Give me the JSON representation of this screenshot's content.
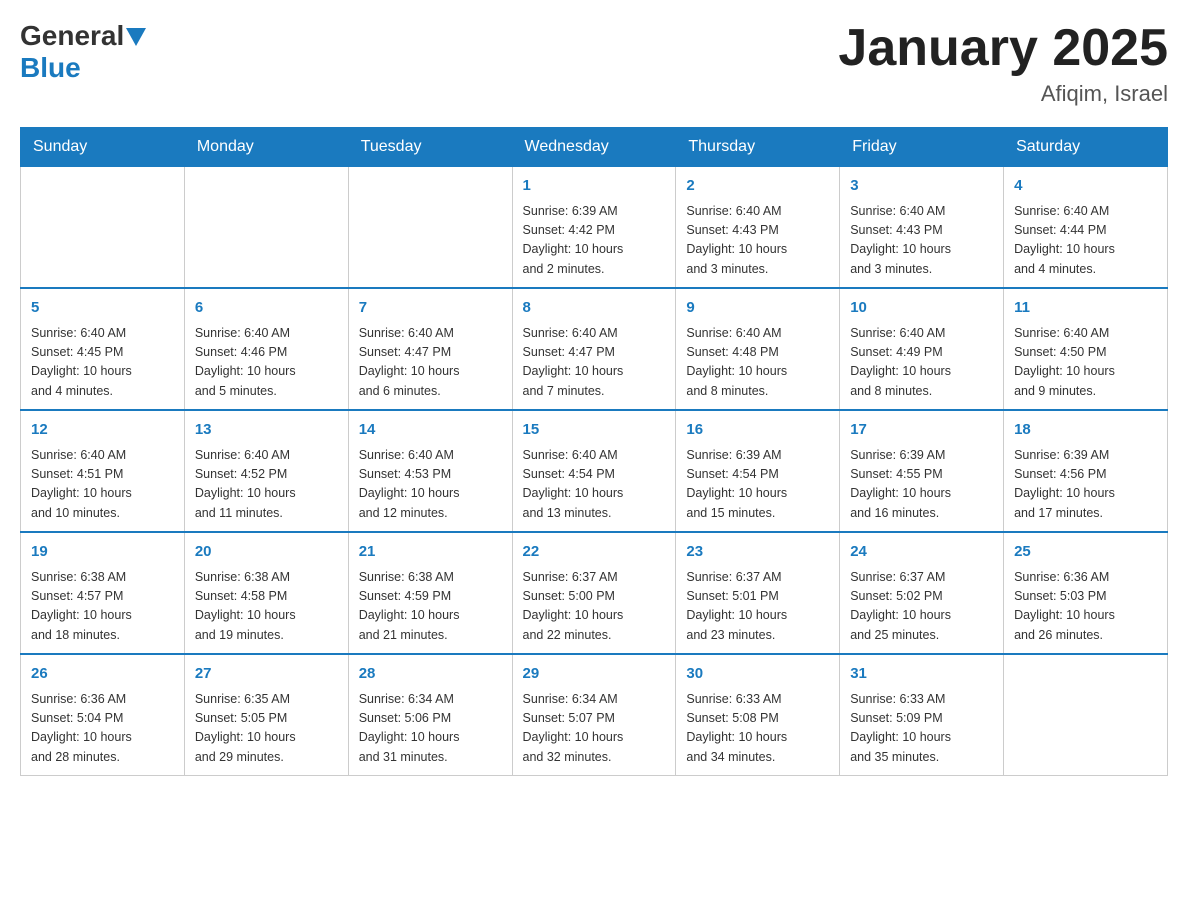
{
  "header": {
    "logo_general": "General",
    "logo_blue": "Blue",
    "month_title": "January 2025",
    "location": "Afiqim, Israel"
  },
  "days_of_week": [
    "Sunday",
    "Monday",
    "Tuesday",
    "Wednesday",
    "Thursday",
    "Friday",
    "Saturday"
  ],
  "weeks": [
    [
      {
        "day": "",
        "info": ""
      },
      {
        "day": "",
        "info": ""
      },
      {
        "day": "",
        "info": ""
      },
      {
        "day": "1",
        "info": "Sunrise: 6:39 AM\nSunset: 4:42 PM\nDaylight: 10 hours\nand 2 minutes."
      },
      {
        "day": "2",
        "info": "Sunrise: 6:40 AM\nSunset: 4:43 PM\nDaylight: 10 hours\nand 3 minutes."
      },
      {
        "day": "3",
        "info": "Sunrise: 6:40 AM\nSunset: 4:43 PM\nDaylight: 10 hours\nand 3 minutes."
      },
      {
        "day": "4",
        "info": "Sunrise: 6:40 AM\nSunset: 4:44 PM\nDaylight: 10 hours\nand 4 minutes."
      }
    ],
    [
      {
        "day": "5",
        "info": "Sunrise: 6:40 AM\nSunset: 4:45 PM\nDaylight: 10 hours\nand 4 minutes."
      },
      {
        "day": "6",
        "info": "Sunrise: 6:40 AM\nSunset: 4:46 PM\nDaylight: 10 hours\nand 5 minutes."
      },
      {
        "day": "7",
        "info": "Sunrise: 6:40 AM\nSunset: 4:47 PM\nDaylight: 10 hours\nand 6 minutes."
      },
      {
        "day": "8",
        "info": "Sunrise: 6:40 AM\nSunset: 4:47 PM\nDaylight: 10 hours\nand 7 minutes."
      },
      {
        "day": "9",
        "info": "Sunrise: 6:40 AM\nSunset: 4:48 PM\nDaylight: 10 hours\nand 8 minutes."
      },
      {
        "day": "10",
        "info": "Sunrise: 6:40 AM\nSunset: 4:49 PM\nDaylight: 10 hours\nand 8 minutes."
      },
      {
        "day": "11",
        "info": "Sunrise: 6:40 AM\nSunset: 4:50 PM\nDaylight: 10 hours\nand 9 minutes."
      }
    ],
    [
      {
        "day": "12",
        "info": "Sunrise: 6:40 AM\nSunset: 4:51 PM\nDaylight: 10 hours\nand 10 minutes."
      },
      {
        "day": "13",
        "info": "Sunrise: 6:40 AM\nSunset: 4:52 PM\nDaylight: 10 hours\nand 11 minutes."
      },
      {
        "day": "14",
        "info": "Sunrise: 6:40 AM\nSunset: 4:53 PM\nDaylight: 10 hours\nand 12 minutes."
      },
      {
        "day": "15",
        "info": "Sunrise: 6:40 AM\nSunset: 4:54 PM\nDaylight: 10 hours\nand 13 minutes."
      },
      {
        "day": "16",
        "info": "Sunrise: 6:39 AM\nSunset: 4:54 PM\nDaylight: 10 hours\nand 15 minutes."
      },
      {
        "day": "17",
        "info": "Sunrise: 6:39 AM\nSunset: 4:55 PM\nDaylight: 10 hours\nand 16 minutes."
      },
      {
        "day": "18",
        "info": "Sunrise: 6:39 AM\nSunset: 4:56 PM\nDaylight: 10 hours\nand 17 minutes."
      }
    ],
    [
      {
        "day": "19",
        "info": "Sunrise: 6:38 AM\nSunset: 4:57 PM\nDaylight: 10 hours\nand 18 minutes."
      },
      {
        "day": "20",
        "info": "Sunrise: 6:38 AM\nSunset: 4:58 PM\nDaylight: 10 hours\nand 19 minutes."
      },
      {
        "day": "21",
        "info": "Sunrise: 6:38 AM\nSunset: 4:59 PM\nDaylight: 10 hours\nand 21 minutes."
      },
      {
        "day": "22",
        "info": "Sunrise: 6:37 AM\nSunset: 5:00 PM\nDaylight: 10 hours\nand 22 minutes."
      },
      {
        "day": "23",
        "info": "Sunrise: 6:37 AM\nSunset: 5:01 PM\nDaylight: 10 hours\nand 23 minutes."
      },
      {
        "day": "24",
        "info": "Sunrise: 6:37 AM\nSunset: 5:02 PM\nDaylight: 10 hours\nand 25 minutes."
      },
      {
        "day": "25",
        "info": "Sunrise: 6:36 AM\nSunset: 5:03 PM\nDaylight: 10 hours\nand 26 minutes."
      }
    ],
    [
      {
        "day": "26",
        "info": "Sunrise: 6:36 AM\nSunset: 5:04 PM\nDaylight: 10 hours\nand 28 minutes."
      },
      {
        "day": "27",
        "info": "Sunrise: 6:35 AM\nSunset: 5:05 PM\nDaylight: 10 hours\nand 29 minutes."
      },
      {
        "day": "28",
        "info": "Sunrise: 6:34 AM\nSunset: 5:06 PM\nDaylight: 10 hours\nand 31 minutes."
      },
      {
        "day": "29",
        "info": "Sunrise: 6:34 AM\nSunset: 5:07 PM\nDaylight: 10 hours\nand 32 minutes."
      },
      {
        "day": "30",
        "info": "Sunrise: 6:33 AM\nSunset: 5:08 PM\nDaylight: 10 hours\nand 34 minutes."
      },
      {
        "day": "31",
        "info": "Sunrise: 6:33 AM\nSunset: 5:09 PM\nDaylight: 10 hours\nand 35 minutes."
      },
      {
        "day": "",
        "info": ""
      }
    ]
  ]
}
